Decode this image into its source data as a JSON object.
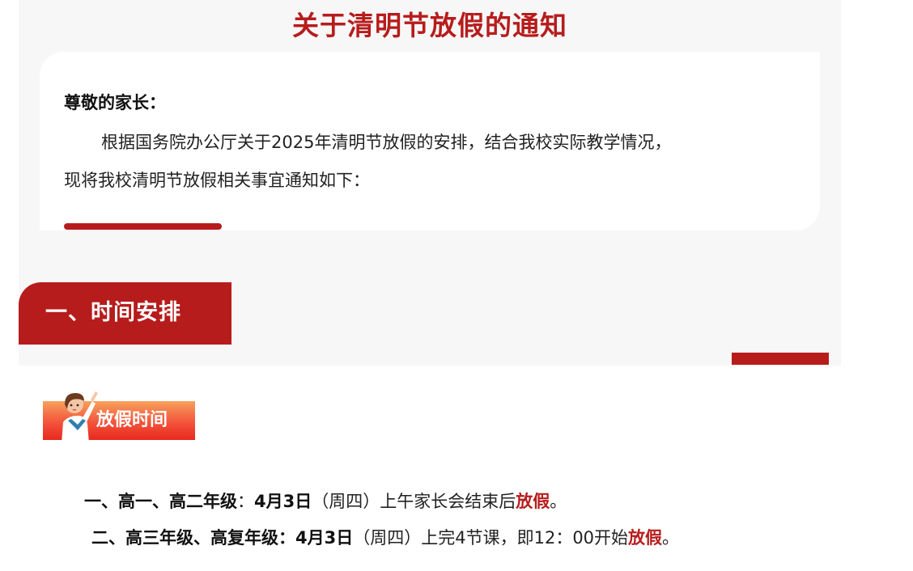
{
  "colors": {
    "accent": "#b71c1c",
    "tag_gradient_start": "#f7a15c",
    "tag_gradient_end": "#e8291e"
  },
  "notice": {
    "title": "关于清明节放假的通知",
    "greeting": "尊敬的家长：",
    "paragraph_part1": "根据国务院办公厅关于2025年清明节放假的安排，结合我校实际教学情况，",
    "paragraph_part2": "现将我校清明节放假相关事宜通知如下："
  },
  "section": {
    "heading": "一、时间安排",
    "tag_label": "放假时间",
    "tag_icon": "teacher-figure-icon"
  },
  "items": [
    {
      "label": "一、高一、高二年级",
      "sep": "：",
      "date": "4月3日",
      "weekday": "（周四）",
      "detail": "上午家长会结束后",
      "highlight": "放假",
      "end": "。"
    },
    {
      "label": "二、高三年级、高复年级：",
      "date": "4月3日",
      "weekday": "（周四）",
      "detail": "上完4节课，即12：00开始",
      "highlight": "放假",
      "end": "。"
    }
  ]
}
